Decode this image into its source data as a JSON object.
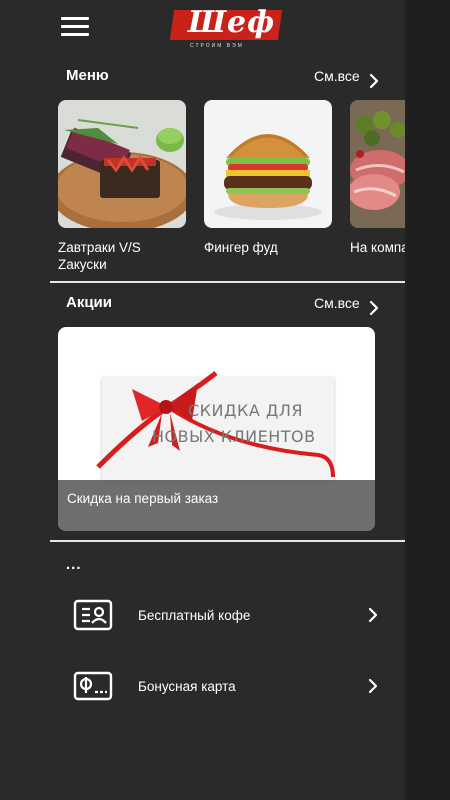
{
  "header": {
    "menu_icon": "hamburger-menu-icon",
    "logo_text": "Шеф",
    "logo_subtitle": "СТРОИМ ВЭМ"
  },
  "menu_section": {
    "title": "Меню",
    "see_all": "См.все",
    "chevron_icon": "chevron-right-icon",
    "items": [
      {
        "label": "Zавтраки V/S\nZакуски",
        "icon": "salmon-toast-photo"
      },
      {
        "label": "Фингер фуд",
        "icon": "burger-photo"
      },
      {
        "label": "На компа",
        "icon": "meat-olives-photo"
      }
    ]
  },
  "promo_section": {
    "title": "Акции",
    "see_all": "См.все",
    "chevron_icon": "chevron-right-icon",
    "banner_line1": "СКИДКА ДЛЯ",
    "banner_line2": "НОВЫХ КЛИЕНТОВ",
    "caption": "Скидка на первый заказ"
  },
  "extra_section": {
    "title": "...",
    "items": [
      {
        "label": "Бесплатный кофе",
        "icon": "coupon-card-icon"
      },
      {
        "label": "Бонусная карта",
        "icon": "bonus-card-icon"
      }
    ]
  },
  "colors": {
    "background": "#2b2a2a",
    "accent_red": "#c9221a",
    "divider": "#e6e6e6"
  }
}
